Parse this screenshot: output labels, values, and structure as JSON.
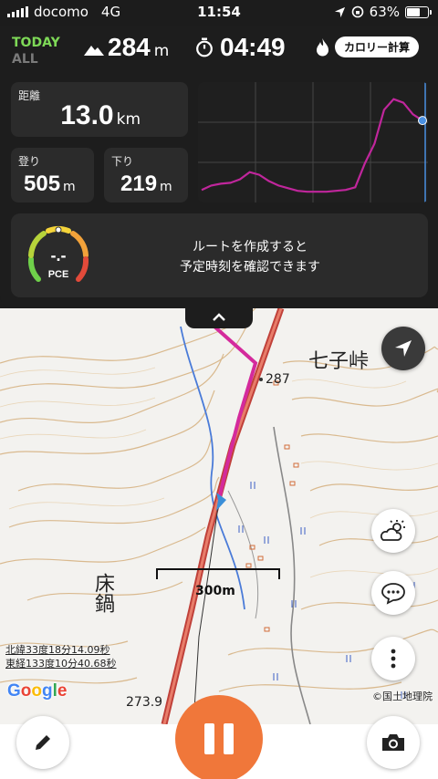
{
  "status_bar": {
    "carrier": "docomo",
    "network": "4G",
    "time": "11:54",
    "battery": "63%",
    "battery_level": 0.63
  },
  "header": {
    "period_selected": "TODAY",
    "period_other": "ALL",
    "elevation_value": "284",
    "elevation_unit": "m",
    "elapsed_time": "04:49",
    "calorie_button": "カロリー計算"
  },
  "stats": {
    "distance": {
      "label": "距離",
      "value": "13.0",
      "unit": "km"
    },
    "ascent": {
      "label": "登り",
      "value": "505",
      "unit": "m"
    },
    "descent": {
      "label": "下り",
      "value": "219",
      "unit": "m"
    }
  },
  "chart_data": {
    "type": "line",
    "title": "",
    "xlabel": "",
    "ylabel": "",
    "series": [
      {
        "values": [
          10,
          15,
          17,
          18,
          22,
          30,
          27,
          20,
          15,
          12,
          9,
          8,
          8,
          8,
          9,
          10,
          13,
          40,
          62,
          100,
          112,
          108,
          95,
          88
        ]
      }
    ],
    "ylim": [
      0,
      125
    ],
    "line_color": "#c0269c",
    "marker_color": "#4a90e2"
  },
  "pce": {
    "label": "PCE",
    "value": "-.-",
    "message_line1": "ルートを作成すると",
    "message_line2": "予定時刻を確認できます"
  },
  "map": {
    "scale_label": "300m",
    "latitude": "北緯33度18分14.09秒",
    "longitude": "東経133度10分40.68秒",
    "attribution": "©国土地理院",
    "place_name": "七子峠",
    "place_name_2": "床鍋",
    "elevation_point_1": "287",
    "elevation_point_2": "273.9",
    "google_letters": [
      "G",
      "o",
      "o",
      "g",
      "l",
      "e"
    ],
    "google_colors": [
      "#4285f4",
      "#ea4335",
      "#fbbc05",
      "#4285f4",
      "#34a853",
      "#ea4335"
    ]
  },
  "buttons": {
    "location_icon": "location-arrow-icon",
    "weather_icon": "weather-icon",
    "chat_icon": "chat-icon",
    "more_icon": "more-icon",
    "edit_icon": "pencil-icon",
    "pause_icon": "pause-icon",
    "camera_icon": "camera-icon"
  }
}
